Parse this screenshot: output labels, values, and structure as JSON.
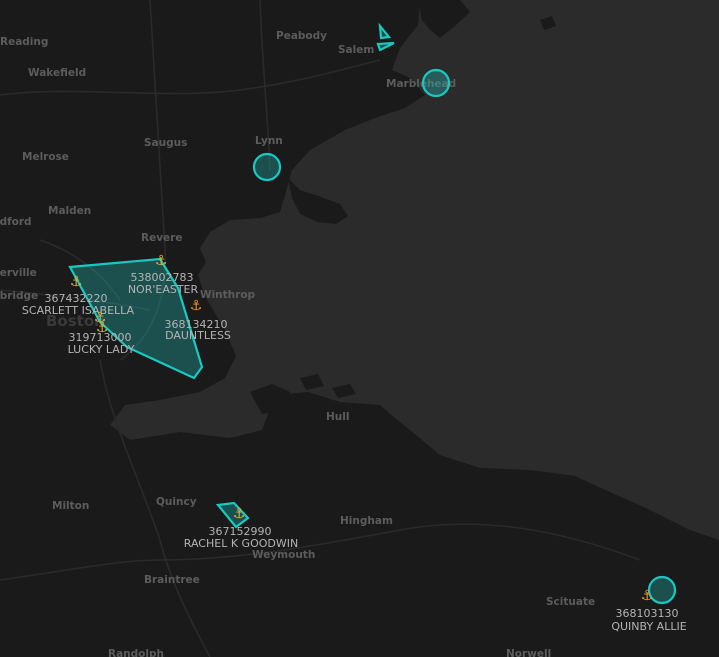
{
  "colors": {
    "water": "#2b2b2b",
    "land": "#1a1a1a",
    "zone": "#19c9c1",
    "anchor_gold": "#d9b23a",
    "anchor_orange": "#f0922a"
  },
  "places": [
    "Reading",
    "Peabody",
    "Salem",
    "Wakefield",
    "Marblehead",
    "Lynn",
    "Saugus",
    "Melrose",
    "Malden",
    "Medford",
    "Revere",
    "Somerville",
    "Cambridge",
    "Boston",
    "Winthrop",
    "Hull",
    "Quincy",
    "Milton",
    "Hingham",
    "Weymouth",
    "Braintree",
    "Scituate",
    "Randolph",
    "Norwell"
  ],
  "vessels": [
    {
      "mmsi": "538002783",
      "name": "NOR'EASTER",
      "icon": "anchor-icon"
    },
    {
      "mmsi": "367432220",
      "name": "SCARLETT ISABELLA",
      "icon": "anchor-icon"
    },
    {
      "mmsi": "368134210",
      "name": "DAUNTLESS",
      "icon": "anchor-icon"
    },
    {
      "mmsi": "319713000",
      "name": "LUCKY LADY",
      "icon": "anchor-icon"
    },
    {
      "mmsi": "367152990",
      "name": "RACHEL K GOODWIN",
      "icon": "anchor-icon"
    },
    {
      "mmsi": "368103130",
      "name": "QUINBY ALLIE",
      "icon": "anchor-icon"
    }
  ]
}
